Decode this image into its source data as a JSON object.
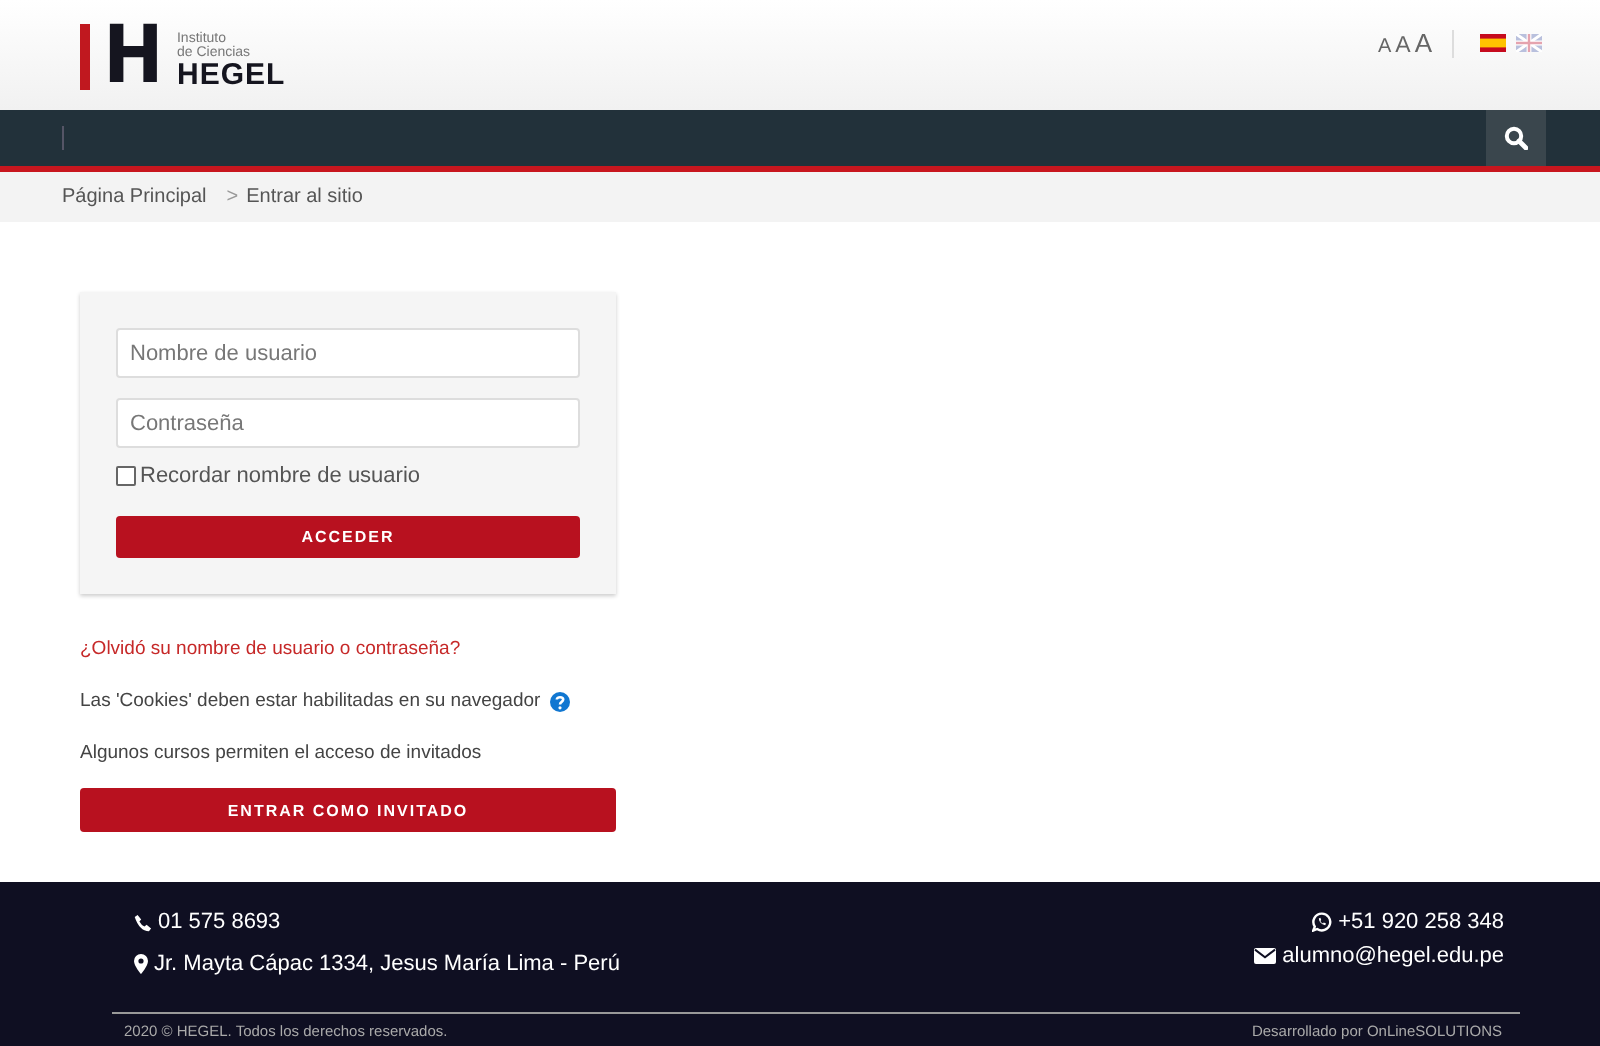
{
  "logo": {
    "mark": "H",
    "line1": "Instituto",
    "line2": "de Ciencias",
    "name": "HEGEL"
  },
  "font_sizes": [
    "A",
    "A",
    "A"
  ],
  "breadcrumb": [
    "Página Principal",
    "Entrar al sitio"
  ],
  "breadcrumb_separator": ">",
  "login": {
    "username": {
      "placeholder": "Nombre de usuario"
    },
    "password": {
      "placeholder": "Contraseña"
    },
    "remember": {
      "label": "Recordar nombre de usuario",
      "checked": false
    },
    "submit": "ACCEDER"
  },
  "forgot_link": "¿Olvidó su nombre de usuario o contraseña?",
  "cookies_note": "Las 'Cookies' deben estar habilitadas en su navegador",
  "guest_note": "Algunos cursos permiten el acceso de invitados",
  "guest_button": "ENTRAR COMO INVITADO",
  "footer": {
    "phone": "01 575 8693",
    "address": "Jr. Mayta Cápac 1334, Jesus María Lima - Perú",
    "whatsapp": "+51 920 258 348",
    "email": "alumno@hegel.edu.pe",
    "copyright": "2020 © HEGEL. Todos los derechos reservados.",
    "credit": "Desarrollado por OnLineSOLUTIONS"
  }
}
